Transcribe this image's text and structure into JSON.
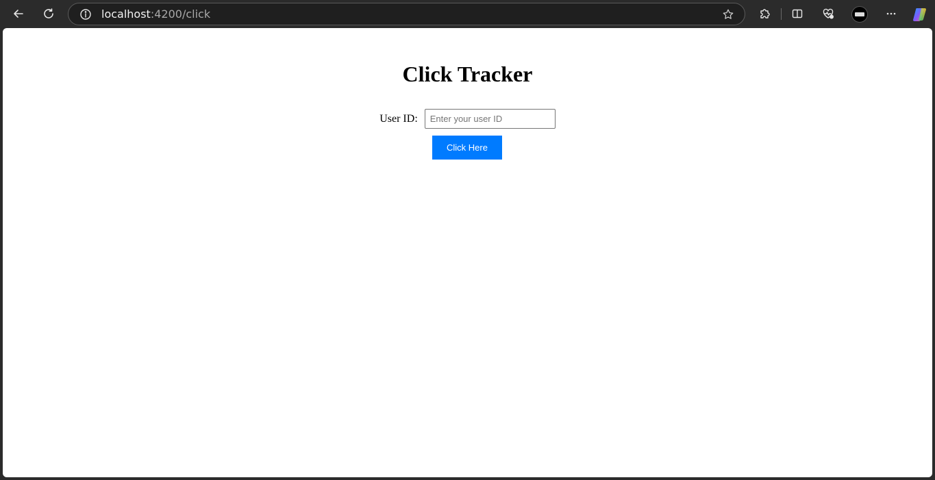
{
  "browser": {
    "url_host": "localhost",
    "url_path": ":4200/click",
    "icons": {
      "back": "arrow-left-icon",
      "reload": "reload-icon",
      "site_info": "info-icon",
      "favorite": "star-icon",
      "extensions": "puzzle-icon",
      "split_screen": "split-screen-icon",
      "performance": "heart-pulse-icon",
      "profile": "profile-avatar-icon",
      "more": "ellipsis-icon",
      "copilot": "copilot-icon"
    }
  },
  "page": {
    "title": "Click Tracker",
    "user_id_label": "User ID:",
    "user_id_value": "",
    "user_id_placeholder": "Enter your user ID",
    "button_label": "Click Here",
    "button_color": "#007bff"
  }
}
